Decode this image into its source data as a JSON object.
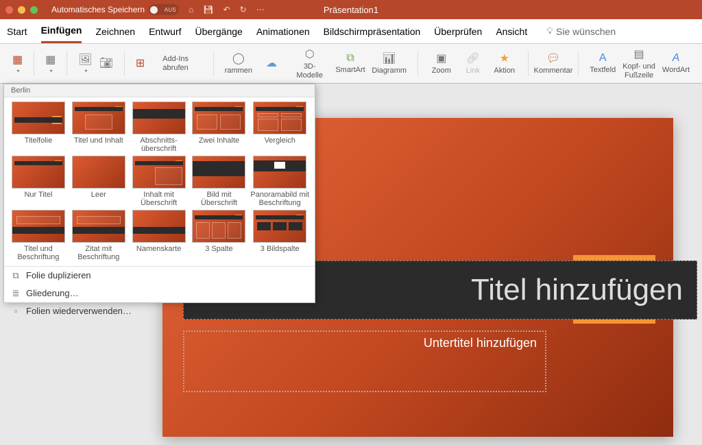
{
  "title_bar": {
    "autosave_label": "Automatisches Speichern",
    "autosave_state": "AUS",
    "doc_title": "Präsentation1"
  },
  "tabs": {
    "items": [
      "Start",
      "Einfügen",
      "Zeichnen",
      "Entwurf",
      "Übergänge",
      "Animationen",
      "Bildschirmpräsentation",
      "Überprüfen",
      "Ansicht"
    ],
    "active_index": 1,
    "tell_me": "Sie wünschen"
  },
  "ribbon": {
    "addins": "Add-Ins abrufen",
    "shapes": "rammen",
    "models3d": "3D-Modelle",
    "smartart": "SmartArt",
    "diagram": "Diagramm",
    "zoom": "Zoom",
    "link": "Link",
    "action": "Aktion",
    "comment": "Kommentar",
    "textbox": "Textfeld",
    "headerfooter": "Kopf- und\nFußzeile",
    "wordart": "WordArt"
  },
  "layout_menu": {
    "theme": "Berlin",
    "layouts": [
      "Titelfolie",
      "Titel und Inhalt",
      "Abschnitts-\nüberschrift",
      "Zwei Inhalte",
      "Vergleich",
      "Nur Titel",
      "Leer",
      "Inhalt mit Überschrift",
      "Bild mit Überschrift",
      "Panoramabild mit\nBeschriftung",
      "Titel und\nBeschriftung",
      "Zitat mit\nBeschriftung",
      "Namenskarte",
      "3 Spalte",
      "3 Bildspalte"
    ],
    "actions": {
      "duplicate": "Folie duplizieren",
      "outline": "Gliederung…",
      "reuse": "Folien wiederverwenden…"
    }
  },
  "slide": {
    "title_placeholder": "Titel hinzufügen",
    "subtitle_placeholder": "Untertitel hinzufügen"
  }
}
